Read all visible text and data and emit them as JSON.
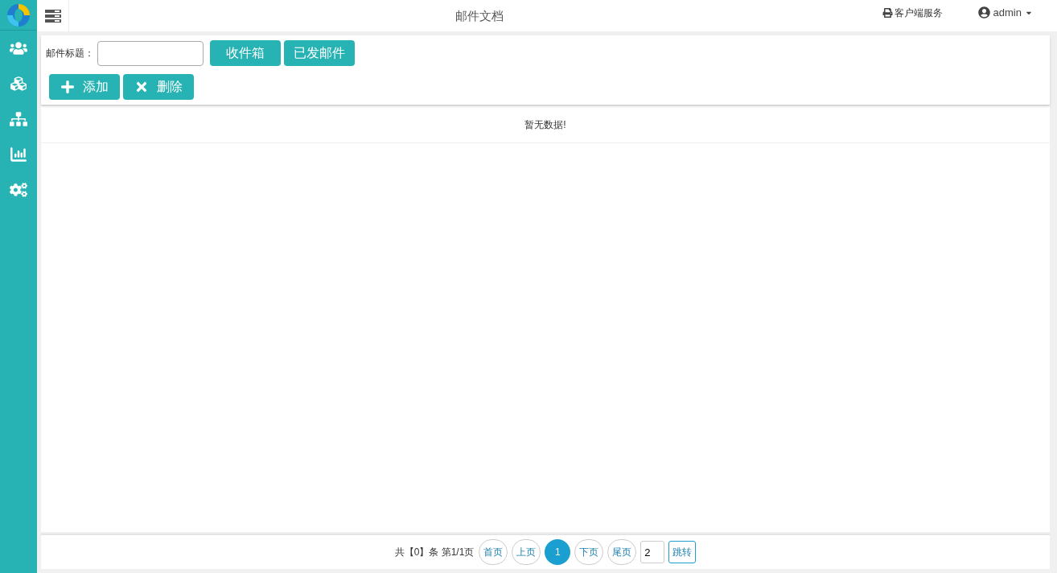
{
  "header": {
    "title": "邮件文档",
    "client_service": "客户端服务",
    "user": "admin"
  },
  "search": {
    "label": "邮件标题："
  },
  "folder_buttons": [
    "收件箱",
    "已发邮件"
  ],
  "actions": [
    {
      "kind": "add",
      "label": "添加"
    },
    {
      "kind": "delete",
      "label": "删除"
    }
  ],
  "empty_message": "暂无数据!",
  "pagination": {
    "summary": "共【0】条 第1/1页",
    "pages": [
      {
        "label": "首页",
        "selected": false
      },
      {
        "label": "上页",
        "selected": false
      },
      {
        "label": "1",
        "selected": true
      },
      {
        "label": "下页",
        "selected": false
      },
      {
        "label": "尾页",
        "selected": false
      }
    ],
    "jump_value": "2",
    "jump_button": "跳转"
  }
}
